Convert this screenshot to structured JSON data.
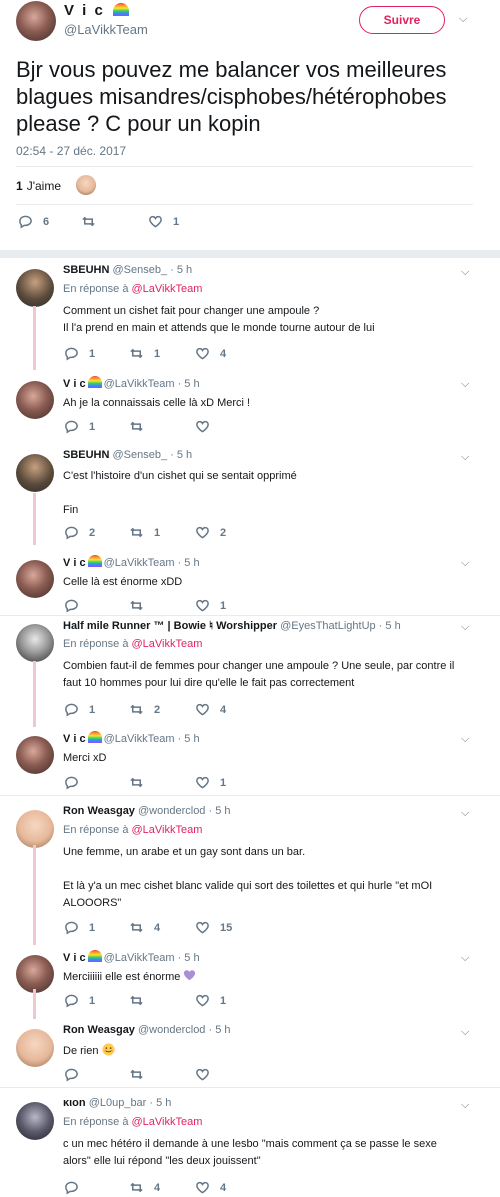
{
  "main_tweet": {
    "display_name": "V i c",
    "handle": "@LaVikkTeam",
    "follow_label": "Suivre",
    "text": "Bjr vous pouvez me balancer vos meilleures blagues misandres/cisphobes/hétérophobes please ? C pour un kopin",
    "timestamp": "02:54 - 27 déc. 2017",
    "likes_count": "1",
    "likes_label": "J'aime",
    "actions": {
      "replies": "6",
      "retweets": "",
      "likes": "1"
    }
  },
  "replies": [
    {
      "name": "SBEUHN",
      "handle": "@Senseb_ · 5 h",
      "in_reply_to_label": "En réponse à",
      "in_reply_to": "@LaVikkTeam",
      "text_lines": [
        "Comment un cishet fait pour changer une ampoule ?",
        "Il l'a prend en main et attends que le monde tourne autour de lui"
      ],
      "replies": "1",
      "retweets": "1",
      "likes": "4"
    },
    {
      "name": "V i c",
      "handle": "@LaVikkTeam · 5 h",
      "text_lines": [
        "Ah je la connaissais celle là xD Merci !"
      ],
      "replies": "1",
      "retweets": "",
      "likes": ""
    },
    {
      "name": "SBEUHN",
      "handle": "@Senseb_ · 5 h",
      "text_lines": [
        "C'est l'histoire d'un cishet qui se sentait opprimé",
        "",
        "Fin"
      ],
      "replies": "2",
      "retweets": "1",
      "likes": "2"
    },
    {
      "name": "V i c",
      "handle": "@LaVikkTeam · 5 h",
      "text_lines": [
        "Celle là est énorme xDD"
      ],
      "replies": "",
      "retweets": "",
      "likes": "1"
    },
    {
      "name": "Half mile Runner ™ | Bowie ♮ Worshipper",
      "handle": "@EyesThatLightUp · 5 h",
      "in_reply_to_label": "En réponse à",
      "in_reply_to": "@LaVikkTeam",
      "text_lines": [
        "Combien faut-il de femmes pour changer une ampoule ? Une seule, par contre il",
        "faut 10 hommes pour lui dire qu'elle le fait pas correctement"
      ],
      "replies": "1",
      "retweets": "2",
      "likes": "4"
    },
    {
      "name": "V i c",
      "handle": "@LaVikkTeam · 5 h",
      "text_lines": [
        "Merci xD"
      ],
      "replies": "",
      "retweets": "",
      "likes": "1"
    },
    {
      "name": "Ron Weasgay",
      "handle": "@wonderclod · 5 h",
      "in_reply_to_label": "En réponse à",
      "in_reply_to": "@LaVikkTeam",
      "text_lines": [
        "Une femme, un arabe et un gay sont dans un bar.",
        "",
        "Et là y'a un mec cishet blanc valide qui sort des toilettes et qui hurle \"et mOI",
        "ALOOORS\""
      ],
      "replies": "1",
      "retweets": "4",
      "likes": "15"
    },
    {
      "name": "V i c",
      "handle": "@LaVikkTeam · 5 h",
      "text_lines": [
        "Merciiiiii elle est énorme"
      ],
      "replies": "1",
      "retweets": "",
      "likes": "1"
    },
    {
      "name": "Ron Weasgay",
      "handle": "@wonderclod · 5 h",
      "text_lines": [
        "De rien"
      ],
      "replies": "",
      "retweets": "",
      "likes": ""
    },
    {
      "name": "ĸιon",
      "handle": "@L0up_bar · 5 h",
      "in_reply_to_label": "En réponse à",
      "in_reply_to": "@LaVikkTeam",
      "text_lines": [
        "c un mec hétéro il demande à une lesbo \"mais comment ça se passe le sexe",
        "alors\" elle lui répond \"les deux jouissent\""
      ],
      "replies": "",
      "retweets": "4",
      "likes": "4"
    }
  ],
  "colors": {
    "accent": "#e0245e",
    "muted": "#657786",
    "thread_line": "#f0c6d0",
    "separator": "#e6ecf0"
  },
  "icons": [
    "reply-icon",
    "retweet-icon",
    "heart-icon",
    "chevron-down-icon",
    "rainbow-icon"
  ]
}
